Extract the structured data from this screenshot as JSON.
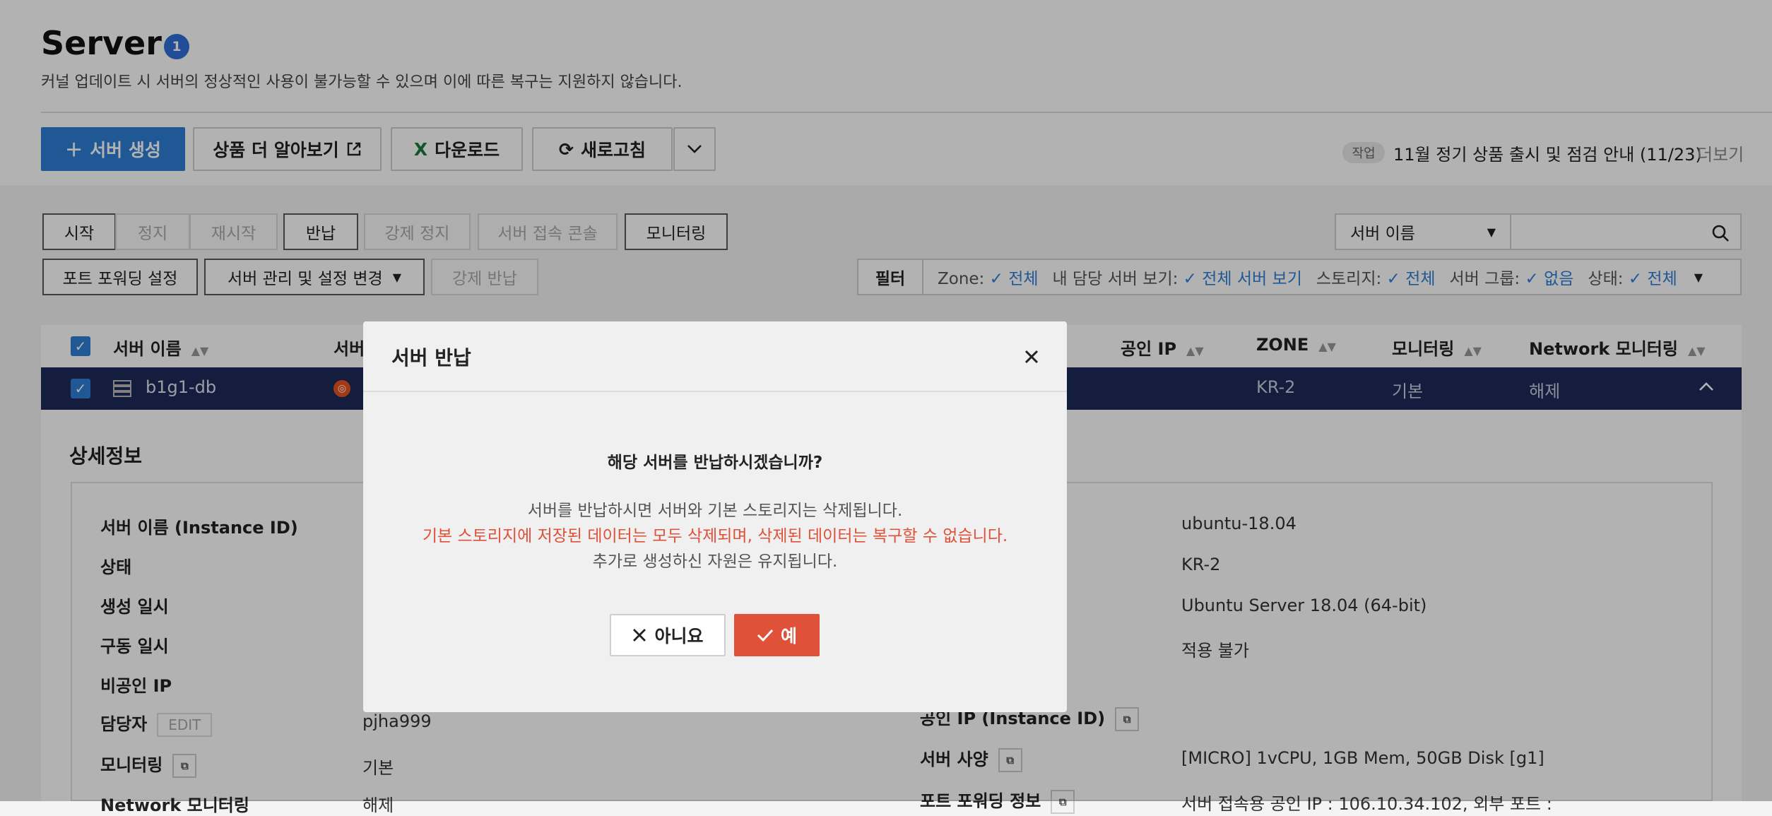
{
  "header": {
    "title": "Server",
    "count": "1",
    "subtitle": "커널 업데이트 시 서버의 정상적인 사용이 불가능할 수 있으며 이에 따른 복구는 지원하지 않습니다."
  },
  "toolbar": {
    "create": "서버 생성",
    "learn_more": "상품 더 알아보기",
    "download": "다운로드",
    "refresh": "새로고침"
  },
  "notice": {
    "tag": "작업",
    "text": "11월 정기 상품 출시 및 점검 안내 (11/23)",
    "more": "더보기"
  },
  "actions": {
    "start": "시작",
    "stop": "정지",
    "restart": "재시작",
    "return": "반납",
    "force_stop": "강제 정지",
    "console": "서버 접속 콘솔",
    "monitoring": "모니터링",
    "port_forwarding": "포트 포워딩 설정",
    "manage": "서버 관리 및 설정 변경",
    "force_return": "강제 반납"
  },
  "search": {
    "select_value": "서버 이름"
  },
  "filter": {
    "label": "필터",
    "zone_label": "Zone:",
    "zone_value": "전체",
    "mine_label": "내 담당 서버 보기:",
    "mine_value": "전체 서버 보기",
    "storage_label": "스토리지:",
    "storage_value": "전체",
    "group_label": "서버 그룹:",
    "group_value": "없음",
    "status_label": "상태:",
    "status_value": "전체"
  },
  "table": {
    "col_name": "서버 이름",
    "col_os": "서버",
    "col_public_ip": "공인 IP",
    "col_zone": "ZONE",
    "col_monitoring": "모니터링",
    "col_network_monitoring": "Network 모니터링",
    "row": {
      "name": "b1g1-db",
      "zone": "KR-2",
      "monitoring": "기본",
      "network_monitoring": "해제"
    }
  },
  "detail": {
    "title": "상세정보",
    "left": {
      "instance_label": "서버 이름 (Instance ID)",
      "status_label": "상태",
      "created_label": "생성 일시",
      "running_label": "구동 일시",
      "private_ip_label": "비공인 IP",
      "manager_label": "담당자",
      "edit": "EDIT",
      "manager_value": "pjha999",
      "monitoring_label": "모니터링",
      "monitoring_value": "기본",
      "network_monitoring_label": "Network 모니터링",
      "network_monitoring_value": "해제"
    },
    "right": {
      "image_value": "ubuntu-18.04",
      "zone_value": "KR-2",
      "os_value": "Ubuntu Server 18.04 (64-bit)",
      "na_value": "적용 불가",
      "public_ip_label": "공인 IP (Instance ID)",
      "spec_label": "서버 사양",
      "spec_value": "[MICRO] 1vCPU, 1GB Mem, 50GB Disk [g1]",
      "port_label": "포트 포워딩 정보",
      "port_value": "서버 접속용 공인 IP : 106.10.34.102, 외부 포트 :"
    }
  },
  "modal": {
    "title": "서버 반납",
    "question": "해당 서버를 반납하시겠습니까?",
    "line1": "서버를 반납하시면 서버와 기본 스토리지는 삭제됩니다.",
    "line2": "기본 스토리지에 저장된 데이터는 모두 삭제되며, 삭제된 데이터는 복구할 수 없습니다.",
    "line3": "추가로 생성하신 자원은 유지됩니다.",
    "no": "아니요",
    "yes": "예"
  },
  "colors": {
    "primary": "#2f7fd6",
    "danger": "#e0513a",
    "selected_row": "#1e2a5a"
  }
}
